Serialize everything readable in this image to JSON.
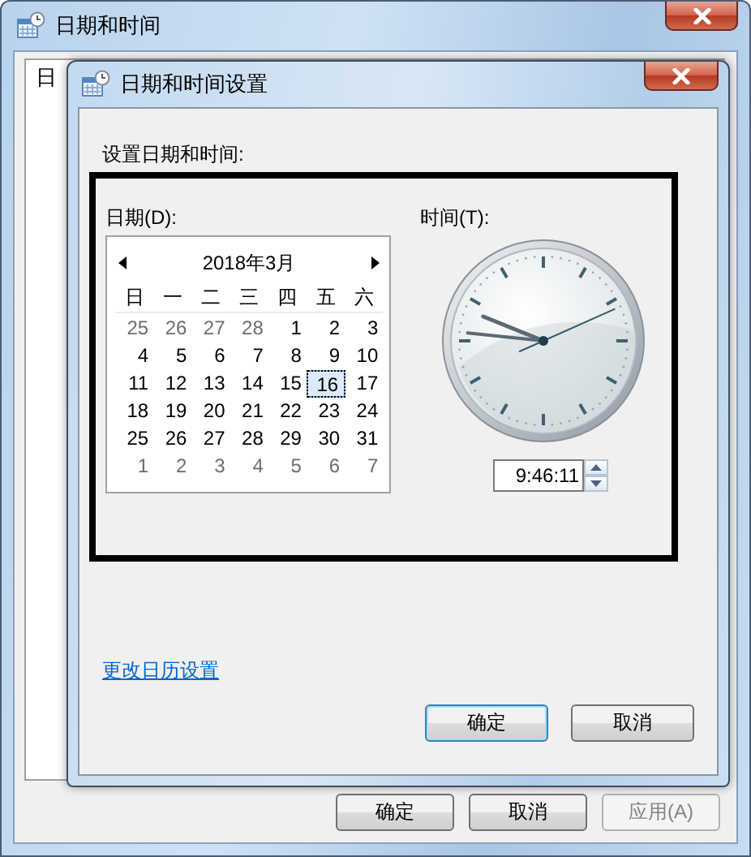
{
  "window": {
    "title": "日期和时间",
    "tab_label": "日",
    "buttons": [
      {
        "label": "确定",
        "disabled": false
      },
      {
        "label": "取消",
        "disabled": false
      },
      {
        "label": "应用(A)",
        "disabled": true
      }
    ]
  },
  "dialog": {
    "title": "日期和时间设置",
    "heading": "设置日期和时间:",
    "date_label": "日期(D):",
    "time_label": "时间(T):",
    "calendar": {
      "month": "2018年3月",
      "weekdays": [
        "日",
        "一",
        "二",
        "三",
        "四",
        "五",
        "六"
      ],
      "days": [
        {
          "day": "25",
          "other_month": true,
          "selected": false
        },
        {
          "day": "26",
          "other_month": true,
          "selected": false
        },
        {
          "day": "27",
          "other_month": true,
          "selected": false
        },
        {
          "day": "28",
          "other_month": true,
          "selected": false
        },
        {
          "day": "1",
          "other_month": false,
          "selected": false
        },
        {
          "day": "2",
          "other_month": false,
          "selected": false
        },
        {
          "day": "3",
          "other_month": false,
          "selected": false
        },
        {
          "day": "4",
          "other_month": false,
          "selected": false
        },
        {
          "day": "5",
          "other_month": false,
          "selected": false
        },
        {
          "day": "6",
          "other_month": false,
          "selected": false
        },
        {
          "day": "7",
          "other_month": false,
          "selected": false
        },
        {
          "day": "8",
          "other_month": false,
          "selected": false
        },
        {
          "day": "9",
          "other_month": false,
          "selected": false
        },
        {
          "day": "10",
          "other_month": false,
          "selected": false
        },
        {
          "day": "11",
          "other_month": false,
          "selected": false
        },
        {
          "day": "12",
          "other_month": false,
          "selected": false
        },
        {
          "day": "13",
          "other_month": false,
          "selected": false
        },
        {
          "day": "14",
          "other_month": false,
          "selected": false
        },
        {
          "day": "15",
          "other_month": false,
          "selected": false
        },
        {
          "day": "16",
          "other_month": false,
          "selected": true
        },
        {
          "day": "17",
          "other_month": false,
          "selected": false
        },
        {
          "day": "18",
          "other_month": false,
          "selected": false
        },
        {
          "day": "19",
          "other_month": false,
          "selected": false
        },
        {
          "day": "20",
          "other_month": false,
          "selected": false
        },
        {
          "day": "21",
          "other_month": false,
          "selected": false
        },
        {
          "day": "22",
          "other_month": false,
          "selected": false
        },
        {
          "day": "23",
          "other_month": false,
          "selected": false
        },
        {
          "day": "24",
          "other_month": false,
          "selected": false
        },
        {
          "day": "25",
          "other_month": false,
          "selected": false
        },
        {
          "day": "26",
          "other_month": false,
          "selected": false
        },
        {
          "day": "27",
          "other_month": false,
          "selected": false
        },
        {
          "day": "28",
          "other_month": false,
          "selected": false
        },
        {
          "day": "29",
          "other_month": false,
          "selected": false
        },
        {
          "day": "30",
          "other_month": false,
          "selected": false
        },
        {
          "day": "31",
          "other_month": false,
          "selected": false
        },
        {
          "day": "1",
          "other_month": true,
          "selected": false
        },
        {
          "day": "2",
          "other_month": true,
          "selected": false
        },
        {
          "day": "3",
          "other_month": true,
          "selected": false
        },
        {
          "day": "4",
          "other_month": true,
          "selected": false
        },
        {
          "day": "5",
          "other_month": true,
          "selected": false
        },
        {
          "day": "6",
          "other_month": true,
          "selected": false
        },
        {
          "day": "7",
          "other_month": true,
          "selected": false
        }
      ]
    },
    "time": "9:46:11",
    "link": "更改日历设置",
    "buttons": [
      {
        "label": "确定",
        "default": true
      },
      {
        "label": "取消",
        "default": false
      }
    ]
  }
}
